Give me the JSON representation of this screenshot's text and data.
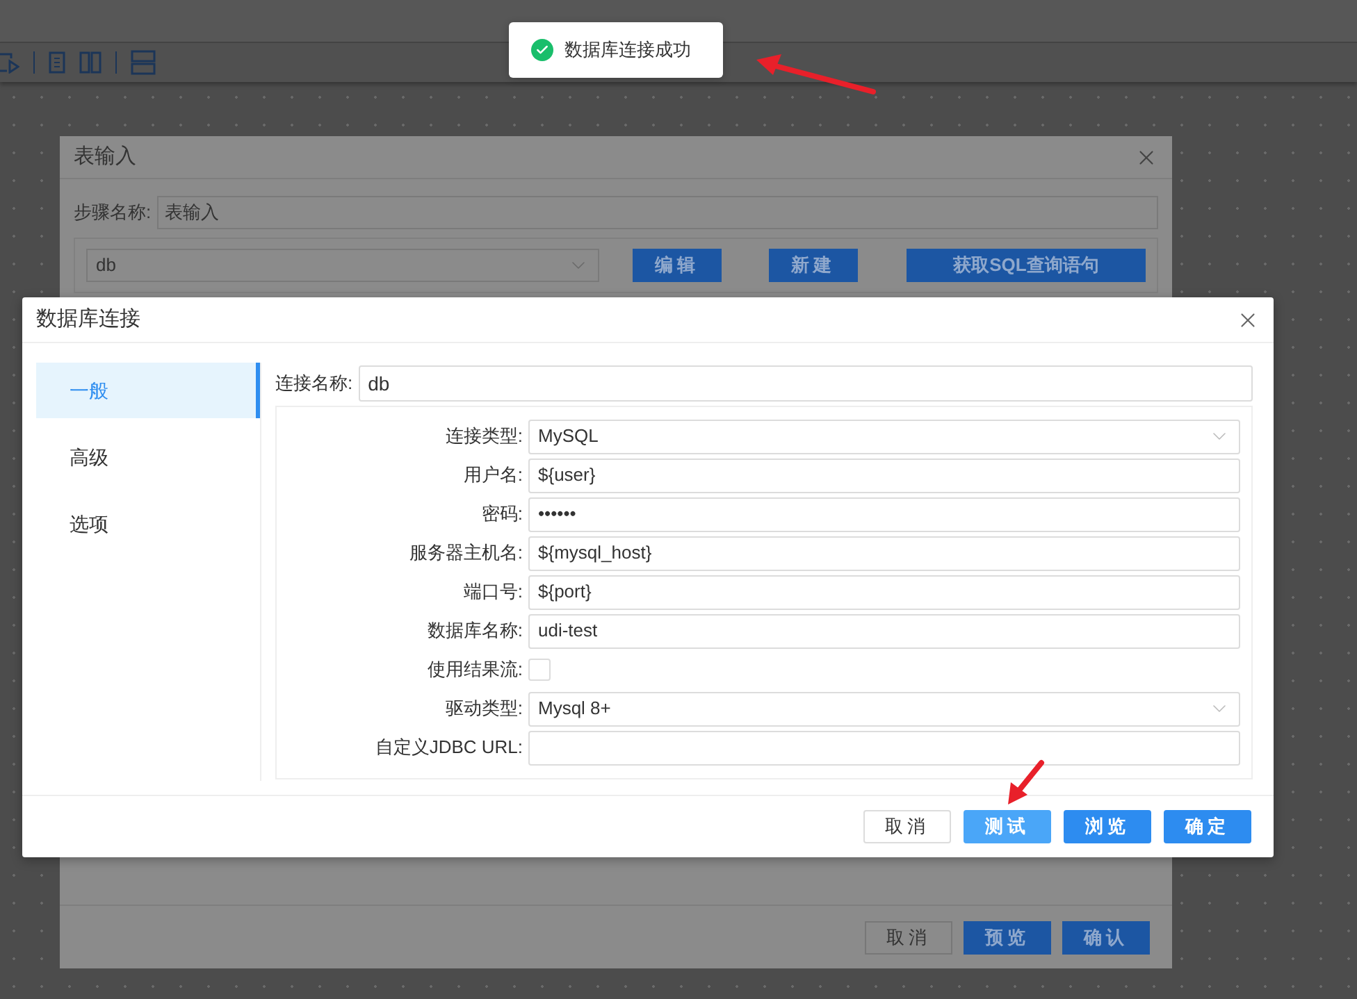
{
  "toast": {
    "kind": "success",
    "text": "数据库连接成功"
  },
  "background_dialog": {
    "title": "表输入",
    "step_name_label": "步骤名称:",
    "step_name_value": "表输入",
    "connection_value": "db",
    "buttons": [
      "编辑",
      "新建",
      "获取SQL查询语句"
    ],
    "footer_buttons": [
      {
        "label": "取消",
        "kind": "default"
      },
      {
        "label": "预览",
        "kind": "primary"
      },
      {
        "label": "确认",
        "kind": "primary"
      }
    ]
  },
  "dialog": {
    "title": "数据库连接",
    "tabs": [
      {
        "label": "一般",
        "selected": true
      },
      {
        "label": "高级",
        "selected": false
      },
      {
        "label": "选项",
        "selected": false
      }
    ],
    "connection_name_label": "连接名称:",
    "connection_name_value": "db",
    "fields": [
      {
        "kind": "select",
        "label": "连接类型:",
        "value": "MySQL"
      },
      {
        "kind": "text",
        "label": "用户名:",
        "value": "${user}"
      },
      {
        "kind": "text",
        "label": "密码:",
        "value": "••••••"
      },
      {
        "kind": "text",
        "label": "服务器主机名:",
        "value": "${mysql_host}"
      },
      {
        "kind": "text",
        "label": "端口号:",
        "value": "${port}"
      },
      {
        "kind": "text",
        "label": "数据库名称:",
        "value": "udi-test"
      },
      {
        "kind": "checkbox",
        "label": "使用结果流:",
        "checked": false
      },
      {
        "kind": "select",
        "label": "驱动类型:",
        "value": "Mysql 8+"
      },
      {
        "kind": "text",
        "label": "自定义JDBC URL:"
      }
    ],
    "buttons": [
      {
        "label": "取消",
        "kind": "default",
        "highlighted": false
      },
      {
        "label": "测试",
        "kind": "primary",
        "highlighted": true
      },
      {
        "label": "浏览",
        "kind": "primary",
        "highlighted": false
      },
      {
        "label": "确定",
        "kind": "primary",
        "highlighted": false
      }
    ]
  }
}
